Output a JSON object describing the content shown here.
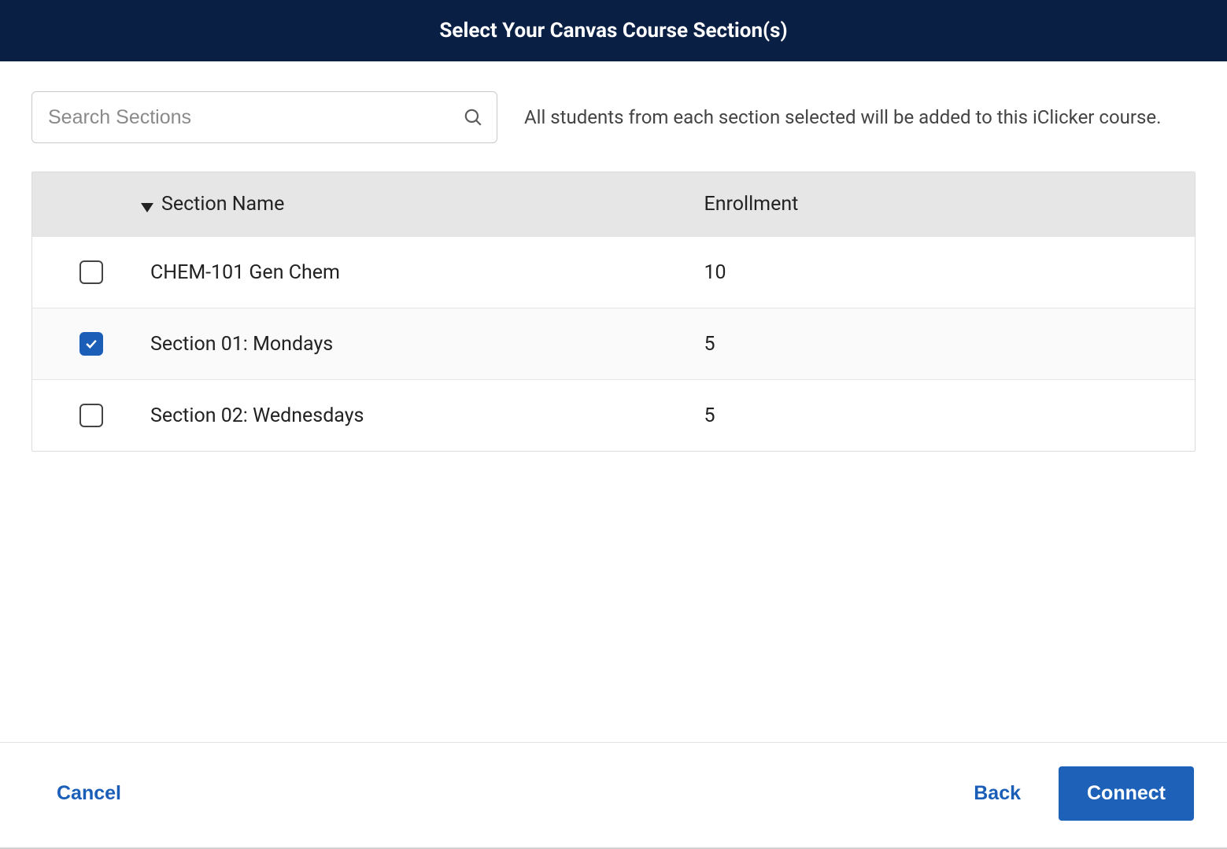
{
  "header": {
    "title": "Select Your Canvas Course Section(s)"
  },
  "search": {
    "placeholder": "Search Sections",
    "value": ""
  },
  "helper_text": "All students from each section selected will be added to this iClicker course.",
  "table": {
    "columns": {
      "section_name": "Section Name",
      "enrollment": "Enrollment"
    },
    "rows": [
      {
        "name": "CHEM-101 Gen Chem",
        "enrollment": "10",
        "checked": false
      },
      {
        "name": "Section 01: Mondays",
        "enrollment": "5",
        "checked": true
      },
      {
        "name": "Section 02: Wednesdays",
        "enrollment": "5",
        "checked": false
      }
    ]
  },
  "footer": {
    "cancel": "Cancel",
    "back": "Back",
    "connect": "Connect"
  }
}
